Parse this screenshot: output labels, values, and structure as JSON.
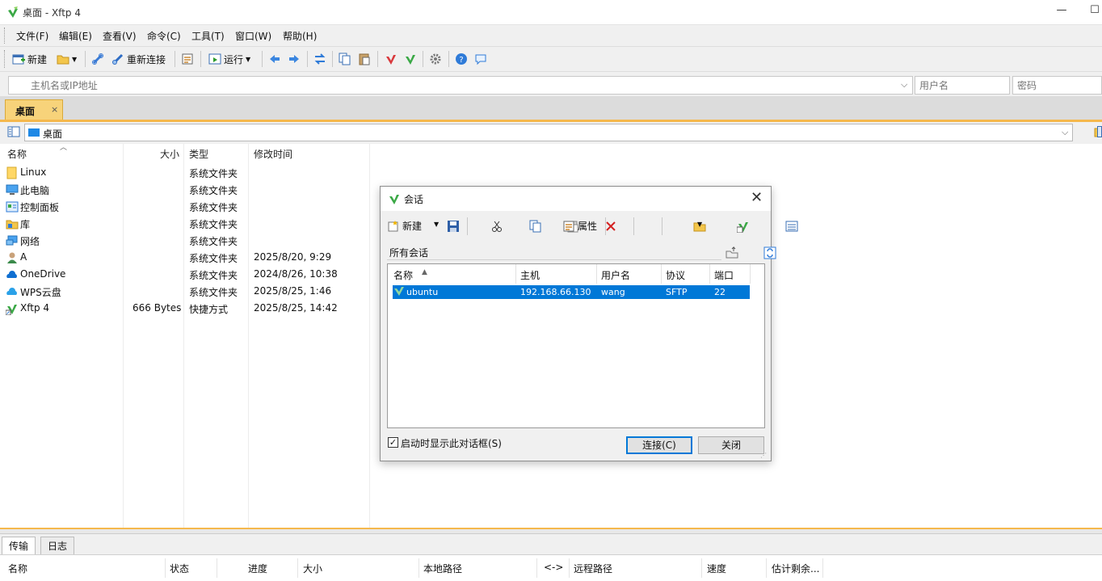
{
  "window": {
    "title": "桌面 - Xftp 4",
    "minimize": "—",
    "maximize": "☐"
  },
  "menu": [
    "文件(F)",
    "编辑(E)",
    "查看(V)",
    "命令(C)",
    "工具(T)",
    "窗口(W)",
    "帮助(H)"
  ],
  "toolbar": {
    "new_label": "新建",
    "reconnect_label": "重新连接",
    "run_label": "运行"
  },
  "address": {
    "host_placeholder": "主机名或IP地址",
    "user_placeholder": "用户名",
    "password_placeholder": "密码"
  },
  "tab": {
    "label": "桌面",
    "close": "×"
  },
  "path": {
    "value": "桌面"
  },
  "file_columns": [
    "名称",
    "大小",
    "类型",
    "修改时间"
  ],
  "files": [
    {
      "name": "Linux",
      "size": "",
      "type": "系统文件夹",
      "mtime": "",
      "icon": "folder-icon"
    },
    {
      "name": "此电脑",
      "size": "",
      "type": "系统文件夹",
      "mtime": "",
      "icon": "computer-icon"
    },
    {
      "name": "控制面板",
      "size": "",
      "type": "系统文件夹",
      "mtime": "",
      "icon": "control-panel-icon"
    },
    {
      "name": "库",
      "size": "",
      "type": "系统文件夹",
      "mtime": "",
      "icon": "library-icon"
    },
    {
      "name": "网络",
      "size": "",
      "type": "系统文件夹",
      "mtime": "",
      "icon": "network-icon"
    },
    {
      "name": "A",
      "size": "",
      "type": "系统文件夹",
      "mtime": "2025/8/20, 9:29",
      "icon": "user-icon"
    },
    {
      "name": "OneDrive",
      "size": "",
      "type": "系统文件夹",
      "mtime": "2024/8/26, 10:38",
      "icon": "cloud-icon"
    },
    {
      "name": "WPS云盘",
      "size": "",
      "type": "系统文件夹",
      "mtime": "2025/8/25, 1:46",
      "icon": "cloud-icon"
    },
    {
      "name": "Xftp 4",
      "size": "666 Bytes",
      "type": "快捷方式",
      "mtime": "2025/8/25, 14:42",
      "icon": "xftp-shortcut-icon"
    }
  ],
  "bottom_tabs": [
    "传输",
    "日志"
  ],
  "transfer_columns": [
    "名称",
    "状态",
    "进度",
    "大小",
    "本地路径",
    "<->",
    "远程路径",
    "速度",
    "估计剩余..."
  ],
  "dialog": {
    "title": "会话",
    "new_label": "新建",
    "props_label": "属性",
    "filter_text": "所有会话",
    "columns": [
      "名称",
      "主机",
      "用户名",
      "协议",
      "端口"
    ],
    "sessions": [
      {
        "name": "ubuntu",
        "host": "192.168.66.130",
        "user": "wang",
        "protocol": "SFTP",
        "port": "22"
      }
    ],
    "startup_checkbox_label": "启动时显示此对话框(S)",
    "startup_checked": true,
    "connect_label": "连接(C)",
    "close_label": "关闭"
  },
  "colors": {
    "accent": "#0078d7",
    "tab_active": "#f7d37a",
    "tab_line": "#f5b84d"
  }
}
